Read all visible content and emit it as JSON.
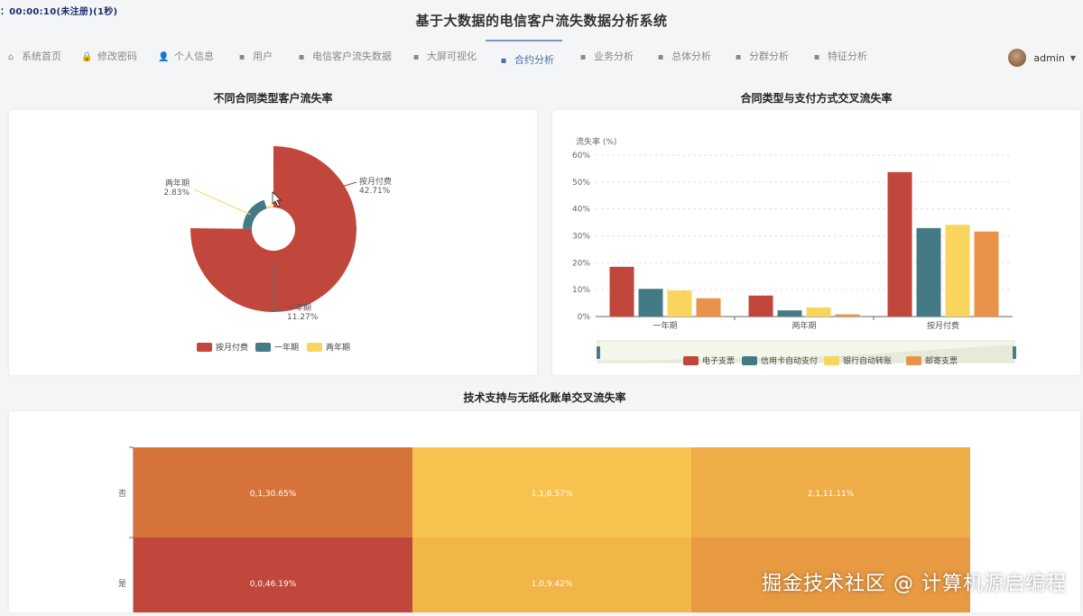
{
  "overlay": {
    "recording_text": "：00:00:10(未注册)(1秒)"
  },
  "app": {
    "title": "基于大数据的电信客户流失数据分析系统"
  },
  "nav": [
    {
      "label": "系统首页",
      "icon": "home-icon",
      "glyph": "⌂"
    },
    {
      "label": "修改密码",
      "icon": "lock-icon",
      "glyph": "🔒"
    },
    {
      "label": "个人信息",
      "icon": "user-icon",
      "glyph": "👤"
    },
    {
      "label": "用户",
      "icon": "grid-icon",
      "glyph": "▪"
    },
    {
      "label": "电信客户流失数据",
      "icon": "grid-icon",
      "glyph": "▪"
    },
    {
      "label": "大屏可视化",
      "icon": "grid-icon",
      "glyph": "▪"
    },
    {
      "label": "合约分析",
      "icon": "grid-icon",
      "glyph": "▪",
      "active": true
    },
    {
      "label": "业务分析",
      "icon": "grid-icon",
      "glyph": "▪"
    },
    {
      "label": "总体分析",
      "icon": "grid-icon",
      "glyph": "▪"
    },
    {
      "label": "分群分析",
      "icon": "grid-icon",
      "glyph": "▪"
    },
    {
      "label": "特征分析",
      "icon": "grid-icon",
      "glyph": "▪"
    }
  ],
  "user": {
    "name": "admin"
  },
  "colors": {
    "red": "#c1463b",
    "teal": "#447a86",
    "yellow": "#fad55e",
    "orange": "#e8924a",
    "active_nav": "#4a6fa5"
  },
  "panels": {
    "pie_title": "不同合同类型客户流失率",
    "bar_title": "合同类型与支付方式交叉流失率",
    "heat_title": "技术支持与无纸化账单交叉流失率"
  },
  "watermark": "掘金技术社区 @ 计算机源启编程",
  "chart_data": [
    {
      "type": "pie",
      "subtype": "rose",
      "categories": [
        "按月付费",
        "一年期",
        "两年期"
      ],
      "values": [
        42.71,
        11.27,
        2.83
      ],
      "labels": [
        "42.71%",
        "11.27%",
        "2.83%"
      ],
      "legend": [
        "按月付费",
        "一年期",
        "两年期"
      ],
      "legend_position": "bottom"
    },
    {
      "type": "bar",
      "ylabel": "流失率 (%)",
      "categories": [
        "一年期",
        "两年期",
        "按月付费"
      ],
      "ylim": [
        0,
        60
      ],
      "yticks": [
        "0%",
        "10%",
        "20%",
        "30%",
        "40%",
        "50%",
        "60%"
      ],
      "series": [
        {
          "name": "电子支票",
          "values": [
            18.5,
            7.8,
            53.7
          ]
        },
        {
          "name": "信用卡自动支付",
          "values": [
            10.3,
            2.3,
            32.9
          ]
        },
        {
          "name": "银行自动转账",
          "values": [
            9.7,
            3.4,
            34.1
          ]
        },
        {
          "name": "邮寄支票",
          "values": [
            6.8,
            0.8,
            31.6
          ]
        }
      ],
      "legend_position": "bottom",
      "grid": true
    },
    {
      "type": "heatmap",
      "y_categories": [
        "否",
        "是"
      ],
      "cells": [
        {
          "row": 0,
          "col": 0,
          "label": "0,1,30.65%",
          "value": 30.65
        },
        {
          "row": 0,
          "col": 1,
          "label": "1,1,6.57%",
          "value": 6.57
        },
        {
          "row": 0,
          "col": 2,
          "label": "2,1,11.11%",
          "value": 11.11
        },
        {
          "row": 1,
          "col": 0,
          "label": "0,0,46.19%",
          "value": 46.19
        },
        {
          "row": 1,
          "col": 1,
          "label": "1,0,9.42%",
          "value": 9.42
        },
        {
          "row": 1,
          "col": 2,
          "label": "",
          "value": 14.5
        }
      ]
    }
  ]
}
